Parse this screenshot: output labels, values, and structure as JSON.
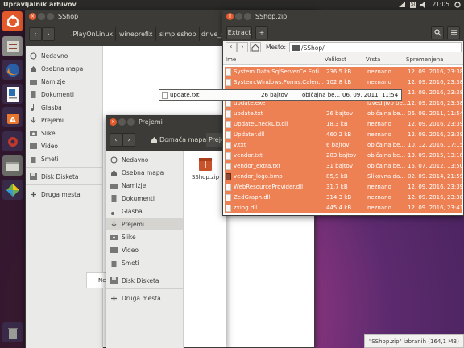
{
  "top_panel": {
    "app_title": "Upravljalnik arhivov",
    "keyboard": "Sl",
    "clock": "21:05"
  },
  "window_back": {
    "title": "SShop",
    "breadcrumbs": [
      ".PlayOnLinux",
      "wineprefix",
      "simpleshop",
      "drive_c"
    ],
    "sidebar": [
      "Nedavno",
      "Osebna mapa",
      "Namizje",
      "Dokumenti",
      "Glasba",
      "Prejemi",
      "Slike",
      "Video",
      "Smeti",
      "Disk Disketa",
      "Druga mesta"
    ]
  },
  "window_prejemi": {
    "title": "Prejemi",
    "breadcrumbs": [
      "Domača mapa",
      "Preje"
    ],
    "sidebar": [
      "Nedavno",
      "Osebna mapa",
      "Namizje",
      "Dokumenti",
      "Glasba",
      "Prejemi",
      "Slike",
      "Video",
      "Smeti",
      "Disk Disketa",
      "Druga mesta"
    ],
    "file": {
      "name": "SShop.zip"
    },
    "partial_text": "Ne"
  },
  "window_archive": {
    "title": "SShop.zip",
    "extract_label": "Extract",
    "add_label": "+",
    "location_label": "Mesto:",
    "location_value": "/SShop/",
    "columns": {
      "name": "Ime",
      "size": "Velikost",
      "type": "Vrsta",
      "modified": "Spremenjena"
    },
    "rows": [
      {
        "name": "System.Data.SqlServerCe.Enti...",
        "size": "236,5 kB",
        "type": "neznano",
        "date": "12. 09. 2016, 23:38",
        "icon": "dll"
      },
      {
        "name": "System.Windows.Forms.Calen...",
        "size": "102,8 kB",
        "type": "neznano",
        "date": "12. 09. 2016, 23:38",
        "icon": "dll"
      },
      {
        "name": "",
        "size": "",
        "type": "",
        "date": "12. 09. 2016, 23:38",
        "icon": "dll"
      },
      {
        "name": "update.exe",
        "size": "",
        "type": "izvedljivo be...",
        "date": "12. 09. 2016, 23:38",
        "icon": "exe"
      },
      {
        "name": "update.txt",
        "size": "26 bajtov",
        "type": "običajna be...",
        "date": "06. 09. 2011, 11:54",
        "icon": "txt"
      },
      {
        "name": "UpdateCheckLib.dll",
        "size": "18,3 kB",
        "type": "neznano",
        "date": "12. 09. 2016, 23:39",
        "icon": "dll"
      },
      {
        "name": "Updater.dll",
        "size": "460,2 kB",
        "type": "neznano",
        "date": "12. 09. 2016, 23:39",
        "icon": "dll"
      },
      {
        "name": "v.txt",
        "size": "6 bajtov",
        "type": "običajna be...",
        "date": "10. 12. 2016, 17:15",
        "icon": "txt"
      },
      {
        "name": "vendor.txt",
        "size": "283 bajtov",
        "type": "običajna be...",
        "date": "19. 09. 2015, 13:18",
        "icon": "txt"
      },
      {
        "name": "vendor_extra.txt",
        "size": "31 bajtov",
        "type": "običajna be...",
        "date": "15. 07. 2012, 13:50",
        "icon": "txt"
      },
      {
        "name": "vendor_logo.bmp",
        "size": "85,9 kB",
        "type": "Slikovna da...",
        "date": "02. 09. 2014, 21:59",
        "icon": "bmp"
      },
      {
        "name": "WebResourceProvider.dll",
        "size": "31,7 kB",
        "type": "neznano",
        "date": "12. 09. 2016, 23:39",
        "icon": "dll"
      },
      {
        "name": "ZedGraph.dll",
        "size": "314,3 kB",
        "type": "neznano",
        "date": "12. 09. 2016, 23:38",
        "icon": "dll"
      },
      {
        "name": "zxing.dll",
        "size": "445,4 kB",
        "type": "neznano",
        "date": "12. 09. 2016, 23:41",
        "icon": "dll"
      }
    ],
    "status": "\"SShop.zip\" izbranih (164,1 MB)"
  },
  "drag": {
    "name": "update.txt",
    "size": "26 bajtov",
    "type": "običajna be...",
    "date": "06. 09. 2011, 11:54"
  },
  "colors": {
    "selection": "#ed8154",
    "ubuntu_orange": "#e25a2c",
    "panel": "#3c3b37"
  }
}
